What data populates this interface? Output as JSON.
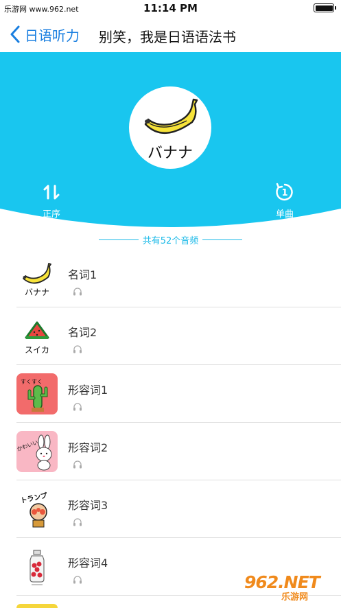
{
  "status_bar": {
    "watermark_left": "乐游网 www.962.net",
    "time": "11:14 PM",
    "battery_level": 1.0
  },
  "nav": {
    "back_label": "日语听力",
    "title": "别笑，我是日语语法书"
  },
  "header": {
    "cover_text": "バナナ",
    "order_label": "正序",
    "single_label": "单曲",
    "single_icon_text": "1",
    "accent_color": "#19c6ef"
  },
  "list": {
    "count_text": "共有52个音频",
    "items": [
      {
        "title": "名词1",
        "thumb": "banana",
        "thumb_text": "バナナ"
      },
      {
        "title": "名词2",
        "thumb": "watermelon",
        "thumb_text": "スイカ"
      },
      {
        "title": "形容词1",
        "thumb": "cactus",
        "thumb_text": "すくすく",
        "bg": "#f26b6b"
      },
      {
        "title": "形容词2",
        "thumb": "rabbit",
        "thumb_text": "かわいい",
        "bg": "#f9b7c4"
      },
      {
        "title": "形容词3",
        "thumb": "trump",
        "thumb_text": "トランプ"
      },
      {
        "title": "形容词4",
        "thumb": "jar",
        "thumb_text": ""
      }
    ]
  },
  "watermark": {
    "logo": "962.NET",
    "sub": "乐游网"
  }
}
